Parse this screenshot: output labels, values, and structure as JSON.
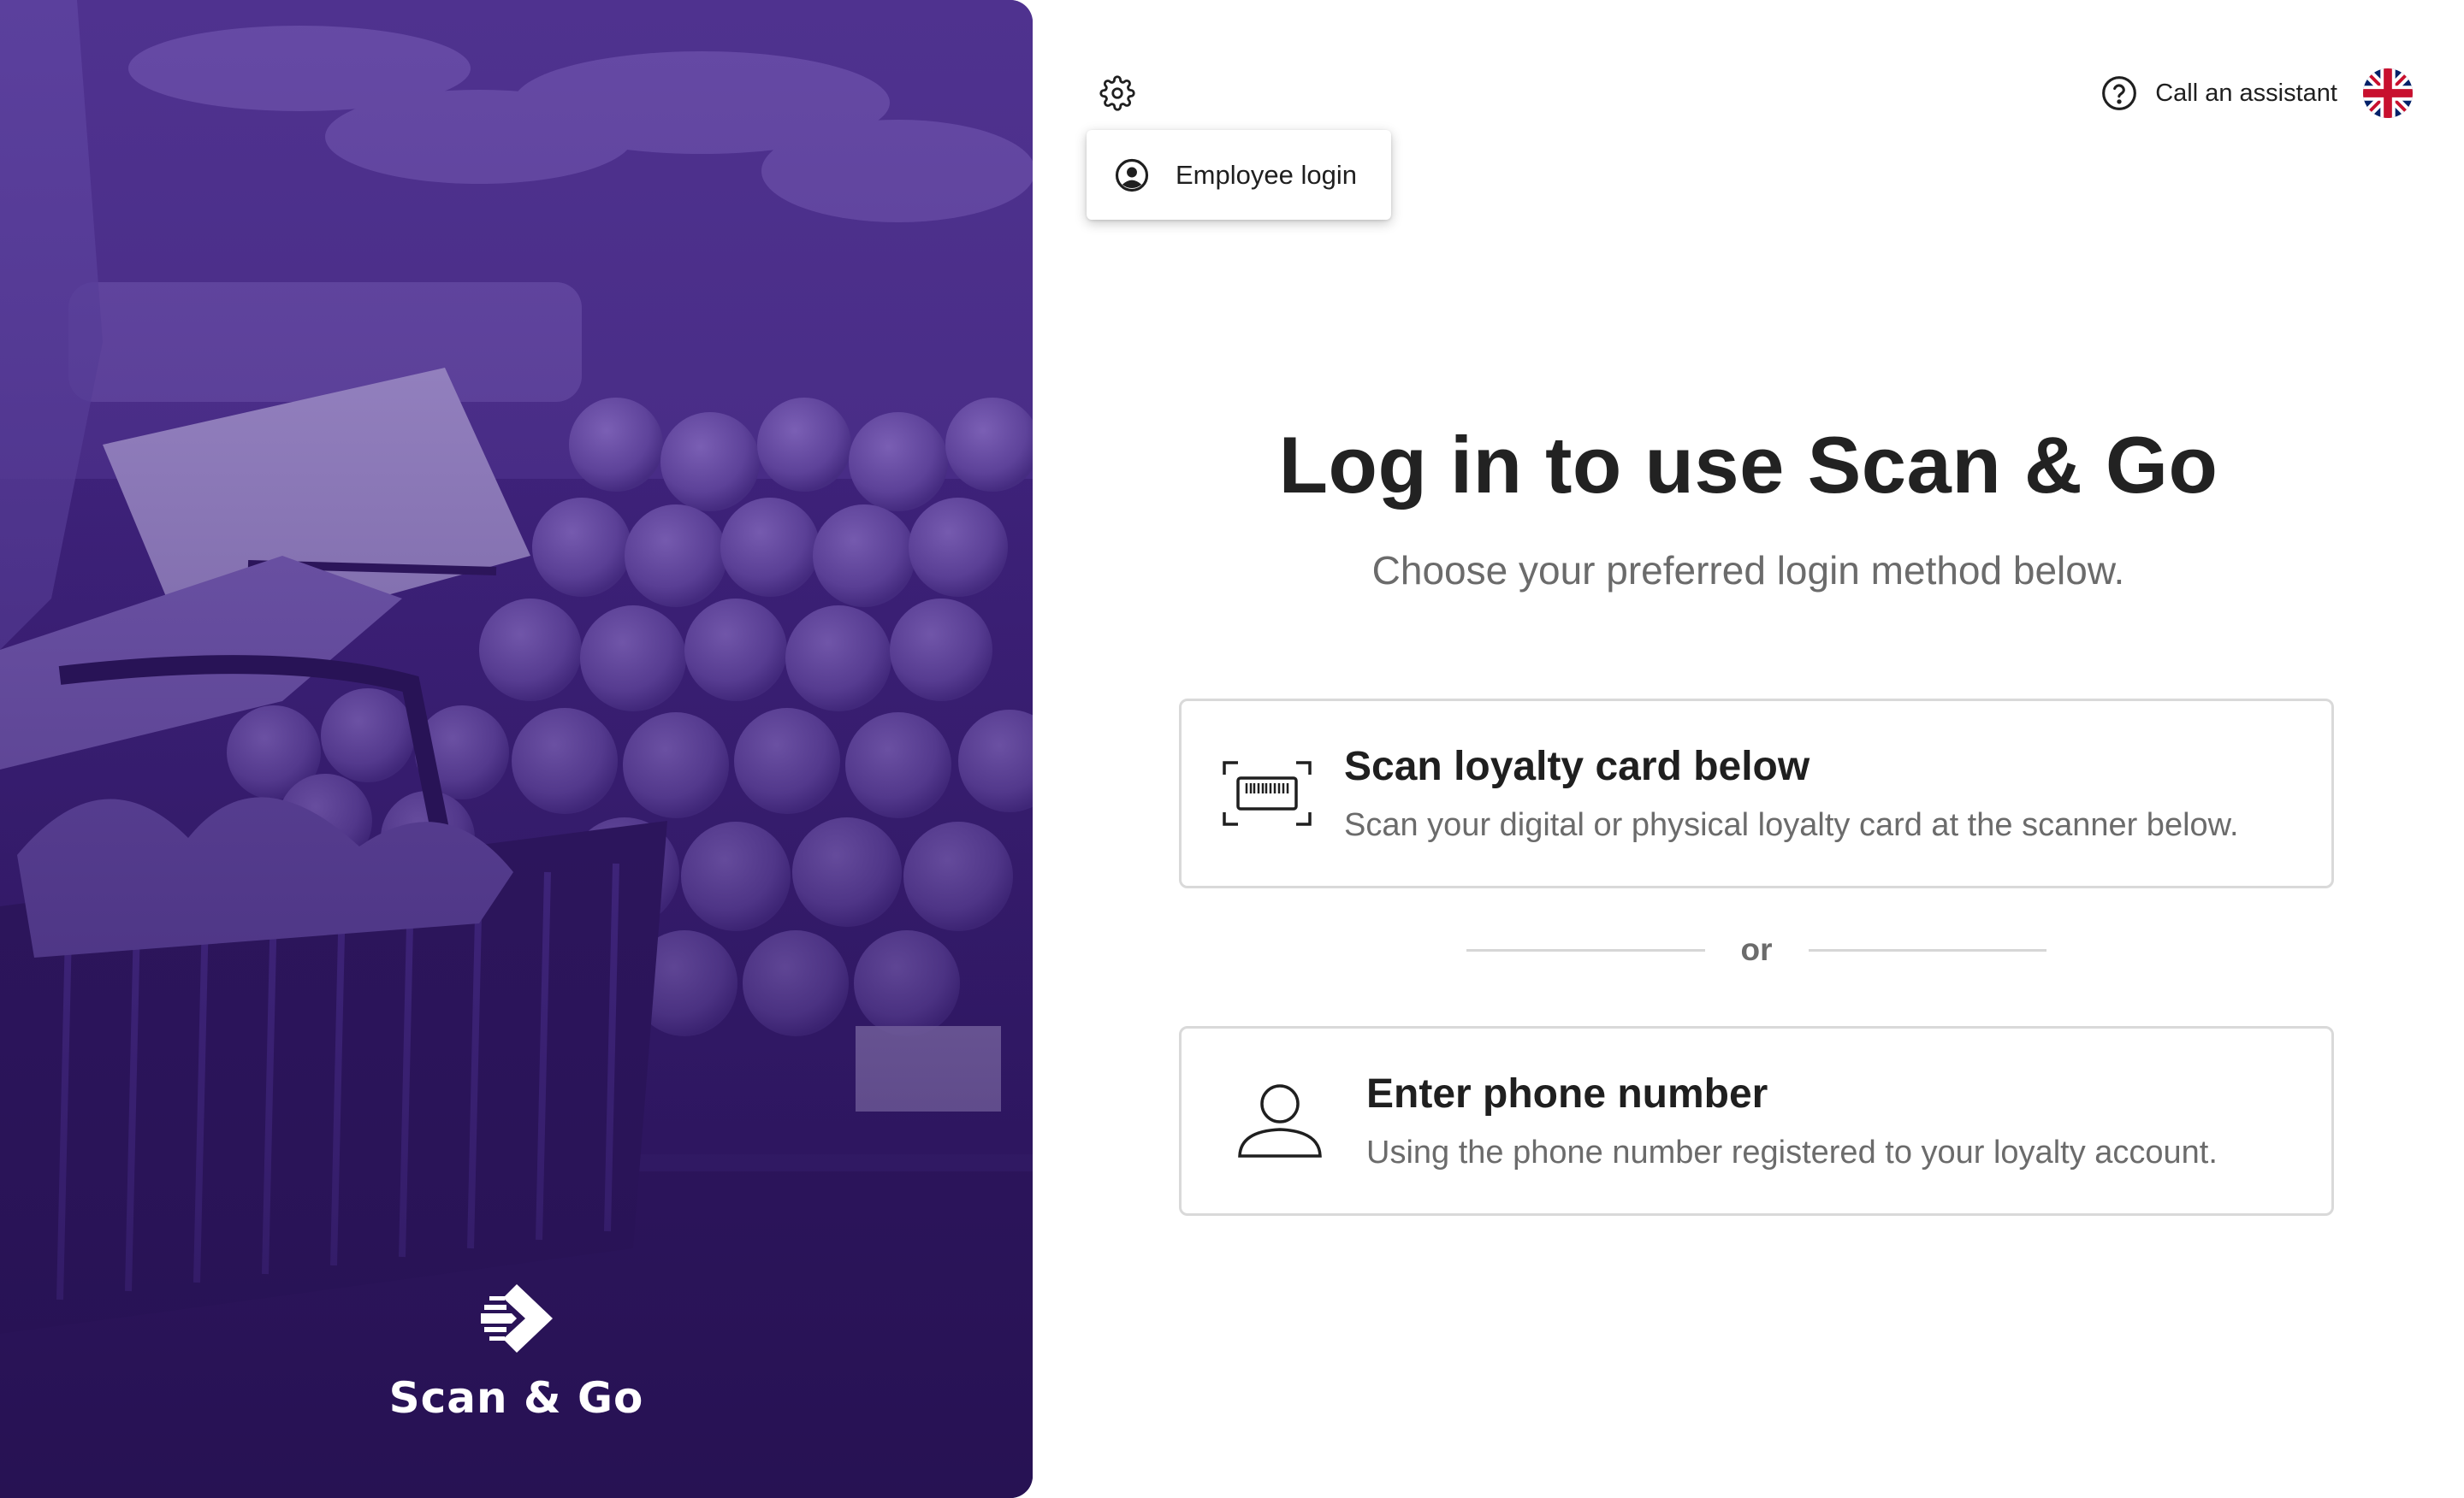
{
  "brand": {
    "name": "Scan & Go"
  },
  "header": {
    "settings_icon": "gear-icon",
    "settings_menu": {
      "items": [
        {
          "label": "Employee login",
          "icon": "user-circle-icon"
        }
      ]
    },
    "assistant": {
      "label": "Call an assistant",
      "icon": "help-circle-icon"
    },
    "language": {
      "icon": "uk-flag-icon",
      "selected": "English (UK)"
    }
  },
  "main": {
    "title": "Log in to use Scan & Go",
    "subtitle": "Choose your preferred login method below.",
    "options": [
      {
        "icon": "barcode-scan-icon",
        "title": "Scan loyalty card below",
        "description": "Scan your digital or physical loyalty card at the scanner below."
      },
      {
        "icon": "person-icon",
        "title": "Enter phone number",
        "description": "Using the phone number registered to your loyalty account."
      }
    ],
    "divider_text": "or"
  },
  "colors": {
    "hero_purple": "#3d2179",
    "text_primary": "#1f1f1f",
    "text_secondary": "#6b6b6b",
    "card_border": "#d9d9d9"
  }
}
